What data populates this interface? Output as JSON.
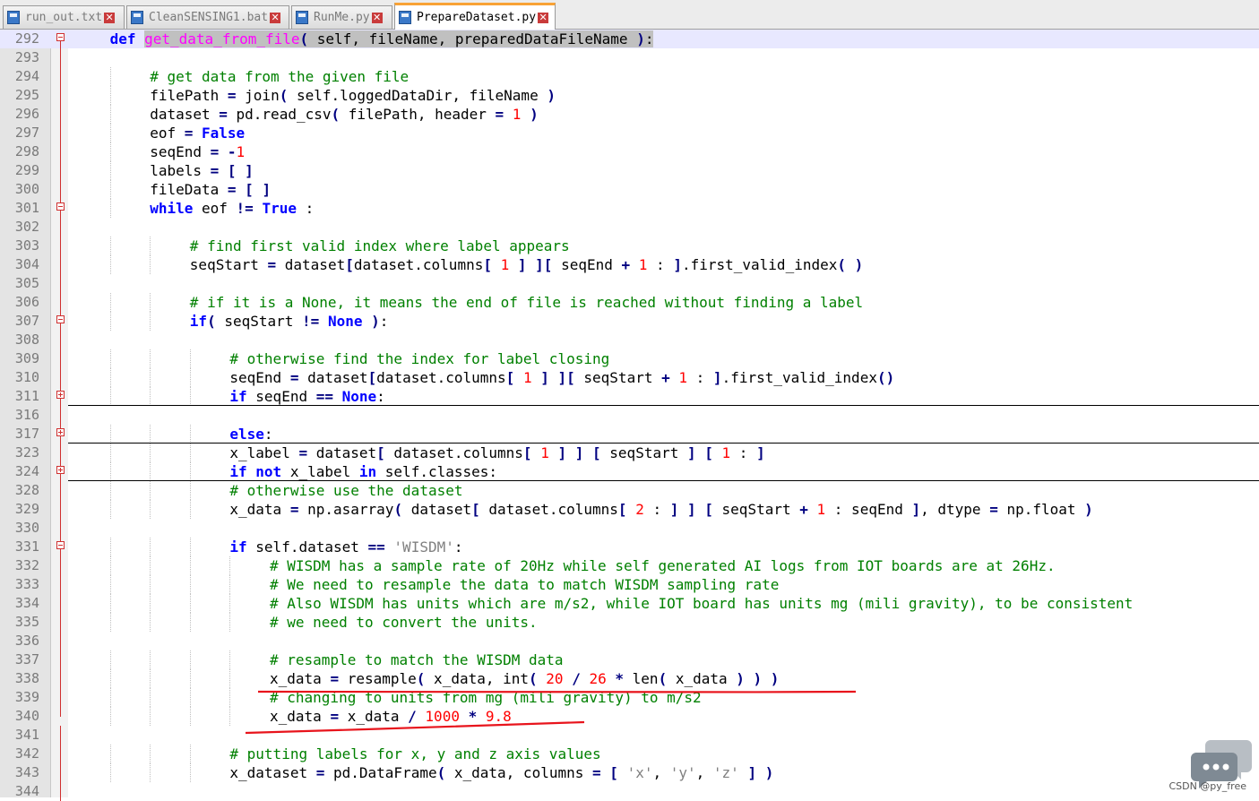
{
  "tabs": [
    {
      "label": "run_out.txt",
      "active": false
    },
    {
      "label": "CleanSENSING1.bat",
      "active": false
    },
    {
      "label": "RunMe.py",
      "active": false
    },
    {
      "label": "PrepareDataset.py",
      "active": true
    }
  ],
  "lines": [
    {
      "n": "292",
      "fold": "minus",
      "indent": 1,
      "cur": true,
      "t": [
        [
          "kw",
          "def "
        ],
        [
          "fn",
          "get_data_from_file"
        ],
        [
          "op",
          "( "
        ],
        [
          "",
          "self, fileName, preparedDataFileName "
        ],
        [
          "op",
          ")"
        ],
        [
          "",
          ":"
        ]
      ]
    },
    {
      "n": "293",
      "fold": "line",
      "indent": 0,
      "t": []
    },
    {
      "n": "294",
      "fold": "line",
      "indent": 2,
      "t": [
        [
          "cm",
          "# get data from the given file"
        ]
      ]
    },
    {
      "n": "295",
      "fold": "line",
      "indent": 2,
      "t": [
        [
          "",
          "filePath "
        ],
        [
          "op",
          "="
        ],
        [
          "",
          " join"
        ],
        [
          "op",
          "("
        ],
        [
          "",
          " self.loggedDataDir, fileName "
        ],
        [
          "op",
          ")"
        ]
      ]
    },
    {
      "n": "296",
      "fold": "line",
      "indent": 2,
      "t": [
        [
          "",
          "dataset "
        ],
        [
          "op",
          "="
        ],
        [
          "",
          " pd.read_csv"
        ],
        [
          "op",
          "("
        ],
        [
          "",
          " filePath, header "
        ],
        [
          "op",
          "="
        ],
        [
          "",
          " "
        ],
        [
          "nm",
          "1"
        ],
        [
          "",
          " "
        ],
        [
          "op",
          ")"
        ]
      ]
    },
    {
      "n": "297",
      "fold": "line",
      "indent": 2,
      "t": [
        [
          "",
          "eof "
        ],
        [
          "op",
          "="
        ],
        [
          "",
          " "
        ],
        [
          "kw",
          "False"
        ]
      ]
    },
    {
      "n": "298",
      "fold": "line",
      "indent": 2,
      "t": [
        [
          "",
          "seqEnd "
        ],
        [
          "op",
          "="
        ],
        [
          "",
          " "
        ],
        [
          "op",
          "-"
        ],
        [
          "nm",
          "1"
        ]
      ]
    },
    {
      "n": "299",
      "fold": "line",
      "indent": 2,
      "t": [
        [
          "",
          "labels "
        ],
        [
          "op",
          "="
        ],
        [
          "",
          " "
        ],
        [
          "op",
          "[ ]"
        ]
      ]
    },
    {
      "n": "300",
      "fold": "line",
      "indent": 2,
      "t": [
        [
          "",
          "fileData "
        ],
        [
          "op",
          "="
        ],
        [
          "",
          " "
        ],
        [
          "op",
          "[ ]"
        ]
      ]
    },
    {
      "n": "301",
      "fold": "minus",
      "indent": 2,
      "t": [
        [
          "kw",
          "while"
        ],
        [
          "",
          " eof "
        ],
        [
          "op",
          "!="
        ],
        [
          "",
          " "
        ],
        [
          "kw",
          "True"
        ],
        [
          "",
          " :"
        ]
      ]
    },
    {
      "n": "302",
      "fold": "line",
      "indent": 0,
      "t": []
    },
    {
      "n": "303",
      "fold": "line",
      "indent": 3,
      "t": [
        [
          "cm",
          "# find first valid index where label appears"
        ]
      ]
    },
    {
      "n": "304",
      "fold": "line",
      "indent": 3,
      "t": [
        [
          "",
          "seqStart "
        ],
        [
          "op",
          "="
        ],
        [
          "",
          " dataset"
        ],
        [
          "op",
          "["
        ],
        [
          "",
          "dataset.columns"
        ],
        [
          "op",
          "["
        ],
        [
          "",
          " "
        ],
        [
          "nm",
          "1"
        ],
        [
          "",
          " "
        ],
        [
          "op",
          "] ]["
        ],
        [
          "",
          " seqEnd "
        ],
        [
          "op",
          "+"
        ],
        [
          "",
          " "
        ],
        [
          "nm",
          "1"
        ],
        [
          "",
          " : "
        ],
        [
          "op",
          "]"
        ],
        [
          "",
          ".first_valid_index"
        ],
        [
          "op",
          "( )"
        ]
      ]
    },
    {
      "n": "305",
      "fold": "line",
      "indent": 0,
      "t": []
    },
    {
      "n": "306",
      "fold": "line",
      "indent": 3,
      "t": [
        [
          "cm",
          "# if it is a None, it means the end of file is reached without finding a label"
        ]
      ]
    },
    {
      "n": "307",
      "fold": "minus",
      "indent": 3,
      "t": [
        [
          "kw",
          "if"
        ],
        [
          "op",
          "("
        ],
        [
          "",
          " seqStart "
        ],
        [
          "op",
          "!="
        ],
        [
          "",
          " "
        ],
        [
          "kw",
          "None"
        ],
        [
          "",
          " "
        ],
        [
          "op",
          ")"
        ],
        [
          "",
          ":"
        ]
      ]
    },
    {
      "n": "308",
      "fold": "line",
      "indent": 0,
      "t": []
    },
    {
      "n": "309",
      "fold": "line",
      "indent": 4,
      "t": [
        [
          "cm",
          "# otherwise find the index for label closing"
        ]
      ]
    },
    {
      "n": "310",
      "fold": "line",
      "indent": 4,
      "t": [
        [
          "",
          "seqEnd "
        ],
        [
          "op",
          "="
        ],
        [
          "",
          " dataset"
        ],
        [
          "op",
          "["
        ],
        [
          "",
          "dataset.columns"
        ],
        [
          "op",
          "["
        ],
        [
          "",
          " "
        ],
        [
          "nm",
          "1"
        ],
        [
          "",
          " "
        ],
        [
          "op",
          "] ]["
        ],
        [
          "",
          " seqStart "
        ],
        [
          "op",
          "+"
        ],
        [
          "",
          " "
        ],
        [
          "nm",
          "1"
        ],
        [
          "",
          " : "
        ],
        [
          "op",
          "]"
        ],
        [
          "",
          ".first_valid_index"
        ],
        [
          "op",
          "()"
        ]
      ]
    },
    {
      "n": "311",
      "fold": "plus",
      "indent": 4,
      "sep": true,
      "t": [
        [
          "kw",
          "if"
        ],
        [
          "",
          " seqEnd "
        ],
        [
          "op",
          "=="
        ],
        [
          "",
          " "
        ],
        [
          "kw",
          "None"
        ],
        [
          "",
          ":"
        ]
      ]
    },
    {
      "n": "316",
      "fold": "line",
      "indent": 0,
      "t": []
    },
    {
      "n": "317",
      "fold": "plus",
      "indent": 4,
      "sep": true,
      "t": [
        [
          "kw",
          "else"
        ],
        [
          "",
          ":"
        ]
      ]
    },
    {
      "n": "323",
      "fold": "line",
      "indent": 4,
      "t": [
        [
          "",
          "x_label "
        ],
        [
          "op",
          "="
        ],
        [
          "",
          " dataset"
        ],
        [
          "op",
          "["
        ],
        [
          "",
          " dataset.columns"
        ],
        [
          "op",
          "["
        ],
        [
          "",
          " "
        ],
        [
          "nm",
          "1"
        ],
        [
          "",
          " "
        ],
        [
          "op",
          "] ] ["
        ],
        [
          "",
          " seqStart "
        ],
        [
          "op",
          "] ["
        ],
        [
          "",
          " "
        ],
        [
          "nm",
          "1"
        ],
        [
          "",
          " : "
        ],
        [
          "op",
          "]"
        ]
      ]
    },
    {
      "n": "324",
      "fold": "plus",
      "indent": 4,
      "sep": true,
      "t": [
        [
          "kw",
          "if not"
        ],
        [
          "",
          " x_label "
        ],
        [
          "kw",
          "in"
        ],
        [
          "",
          " self.classes:"
        ]
      ]
    },
    {
      "n": "328",
      "fold": "line",
      "indent": 4,
      "t": [
        [
          "cm",
          "# otherwise use the dataset"
        ]
      ]
    },
    {
      "n": "329",
      "fold": "line",
      "indent": 4,
      "t": [
        [
          "",
          "x_data "
        ],
        [
          "op",
          "="
        ],
        [
          "",
          " np.asarray"
        ],
        [
          "op",
          "("
        ],
        [
          "",
          " dataset"
        ],
        [
          "op",
          "["
        ],
        [
          "",
          " dataset.columns"
        ],
        [
          "op",
          "["
        ],
        [
          "",
          " "
        ],
        [
          "nm",
          "2"
        ],
        [
          "",
          " : "
        ],
        [
          "op",
          "] ] ["
        ],
        [
          "",
          " seqStart "
        ],
        [
          "op",
          "+"
        ],
        [
          "",
          " "
        ],
        [
          "nm",
          "1"
        ],
        [
          "",
          " : seqEnd "
        ],
        [
          "op",
          "]"
        ],
        [
          "",
          ", dtype "
        ],
        [
          "op",
          "="
        ],
        [
          "",
          " np.float "
        ],
        [
          "op",
          ")"
        ]
      ]
    },
    {
      "n": "330",
      "fold": "line",
      "indent": 0,
      "t": []
    },
    {
      "n": "331",
      "fold": "minus",
      "indent": 4,
      "t": [
        [
          "kw",
          "if"
        ],
        [
          "",
          " self.dataset "
        ],
        [
          "op",
          "=="
        ],
        [
          "",
          " "
        ],
        [
          "st",
          "'WISDM'"
        ],
        [
          "",
          ":"
        ]
      ]
    },
    {
      "n": "332",
      "fold": "line",
      "indent": 5,
      "t": [
        [
          "cm",
          "# WISDM has a sample rate of 20Hz while self generated AI logs from IOT boards are at 26Hz."
        ]
      ]
    },
    {
      "n": "333",
      "fold": "line",
      "indent": 5,
      "t": [
        [
          "cm",
          "# We need to resample the data to match WISDM sampling rate"
        ]
      ]
    },
    {
      "n": "334",
      "fold": "line",
      "indent": 5,
      "t": [
        [
          "cm",
          "# Also WISDM has units which are m/s2, while IOT board has units mg (mili gravity), to be consistent"
        ]
      ]
    },
    {
      "n": "335",
      "fold": "line",
      "indent": 5,
      "t": [
        [
          "cm",
          "# we need to convert the units."
        ]
      ]
    },
    {
      "n": "336",
      "fold": "line",
      "indent": 0,
      "t": []
    },
    {
      "n": "337",
      "fold": "line",
      "indent": 5,
      "t": [
        [
          "cm",
          "# resample to match the WISDM data"
        ]
      ]
    },
    {
      "n": "338",
      "fold": "line",
      "indent": 5,
      "t": [
        [
          "",
          "x_data "
        ],
        [
          "op",
          "="
        ],
        [
          "",
          " resample"
        ],
        [
          "op",
          "("
        ],
        [
          "",
          " x_data, int"
        ],
        [
          "op",
          "("
        ],
        [
          "",
          " "
        ],
        [
          "nm",
          "20"
        ],
        [
          "",
          " "
        ],
        [
          "op",
          "/"
        ],
        [
          "",
          " "
        ],
        [
          "nm",
          "26"
        ],
        [
          "",
          " "
        ],
        [
          "op",
          "*"
        ],
        [
          "",
          " len"
        ],
        [
          "op",
          "("
        ],
        [
          "",
          " x_data "
        ],
        [
          "op",
          ") ) )"
        ]
      ]
    },
    {
      "n": "339",
      "fold": "line",
      "indent": 5,
      "t": [
        [
          "cm",
          "# changing to units from mg (mili gravity) to m/s2"
        ]
      ]
    },
    {
      "n": "340",
      "fold": "end",
      "indent": 5,
      "t": [
        [
          "",
          "x_data "
        ],
        [
          "op",
          "="
        ],
        [
          "",
          " x_data "
        ],
        [
          "op",
          "/"
        ],
        [
          "",
          " "
        ],
        [
          "nm",
          "1000"
        ],
        [
          "",
          " "
        ],
        [
          "op",
          "*"
        ],
        [
          "",
          " "
        ],
        [
          "nm",
          "9.8"
        ]
      ]
    },
    {
      "n": "341",
      "fold": "line",
      "indent": 0,
      "t": []
    },
    {
      "n": "342",
      "fold": "line",
      "indent": 4,
      "t": [
        [
          "cm",
          "# putting labels for x, y and z axis values"
        ]
      ]
    },
    {
      "n": "343",
      "fold": "line",
      "indent": 4,
      "t": [
        [
          "",
          "x_dataset "
        ],
        [
          "op",
          "="
        ],
        [
          "",
          " pd.DataFrame"
        ],
        [
          "op",
          "("
        ],
        [
          "",
          " x_data, columns "
        ],
        [
          "op",
          "="
        ],
        [
          "",
          " "
        ],
        [
          "op",
          "["
        ],
        [
          "",
          " "
        ],
        [
          "st",
          "'x'"
        ],
        [
          "",
          ", "
        ],
        [
          "st",
          "'y'"
        ],
        [
          "",
          ", "
        ],
        [
          "st",
          "'z'"
        ],
        [
          "",
          " "
        ],
        [
          "op",
          "] )"
        ]
      ]
    },
    {
      "n": "344",
      "fold": "line",
      "indent": 0,
      "t": []
    }
  ],
  "annotation_color": "#e8141c",
  "watermark": {
    "icon": "chat-bubble-icon",
    "text": "CSDN @py_free"
  }
}
